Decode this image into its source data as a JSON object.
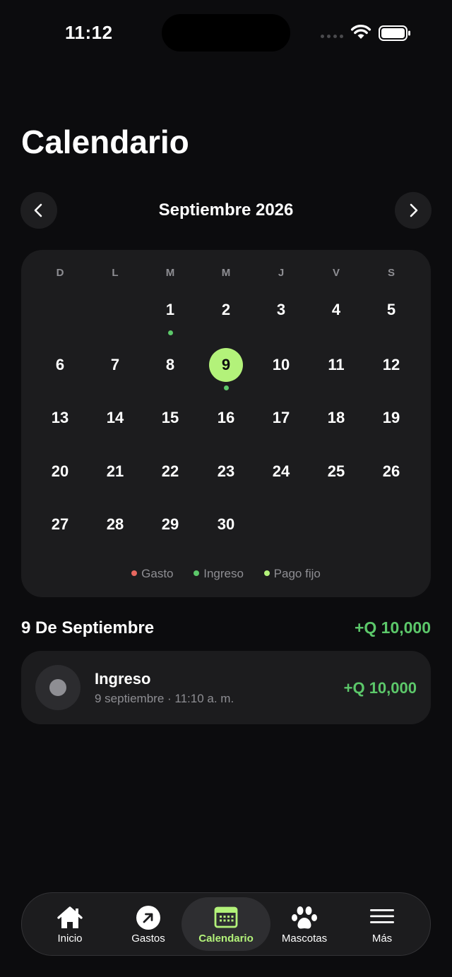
{
  "status_bar": {
    "time": "11:12"
  },
  "header": {
    "title": "Calendario"
  },
  "month_nav": {
    "label": "Septiembre 2026",
    "prev_icon": "chevron-left-icon",
    "next_icon": "chevron-right-icon"
  },
  "calendar": {
    "weekdays": [
      "D",
      "L",
      "M",
      "M",
      "J",
      "V",
      "S"
    ],
    "days": [
      "1",
      "2",
      "3",
      "4",
      "5",
      "6",
      "7",
      "8",
      "9",
      "10",
      "11",
      "12",
      "13",
      "14",
      "15",
      "16",
      "17",
      "18",
      "19",
      "20",
      "21",
      "22",
      "23",
      "24",
      "25",
      "26",
      "27",
      "28",
      "29",
      "30"
    ],
    "selected_day": "9",
    "marked_days": [
      "1",
      "9"
    ],
    "legend": [
      {
        "label": "Gasto",
        "color": "#e8675f"
      },
      {
        "label": "Ingreso",
        "color": "#5cc86a"
      },
      {
        "label": "Pago fijo",
        "color": "#b3f27a"
      }
    ]
  },
  "day_section": {
    "title": "9 De Septiembre",
    "total": "+Q 10,000",
    "transactions": [
      {
        "name": "Ingreso",
        "subtitle": "9 septiembre · 11:10 a. m.",
        "amount": "+Q 10,000"
      }
    ]
  },
  "tabbar": {
    "items": [
      {
        "label": "Inicio",
        "icon": "home-icon"
      },
      {
        "label": "Gastos",
        "icon": "arrow-up-right-icon"
      },
      {
        "label": "Calendario",
        "icon": "calendar-icon",
        "active": true
      },
      {
        "label": "Mascotas",
        "icon": "paw-icon"
      },
      {
        "label": "Más",
        "icon": "menu-icon"
      }
    ]
  },
  "colors": {
    "accent": "#b3f27a",
    "income": "#5cc86a",
    "expense": "#e8675f",
    "background": "#0c0c0e",
    "card": "#1c1c1e"
  }
}
